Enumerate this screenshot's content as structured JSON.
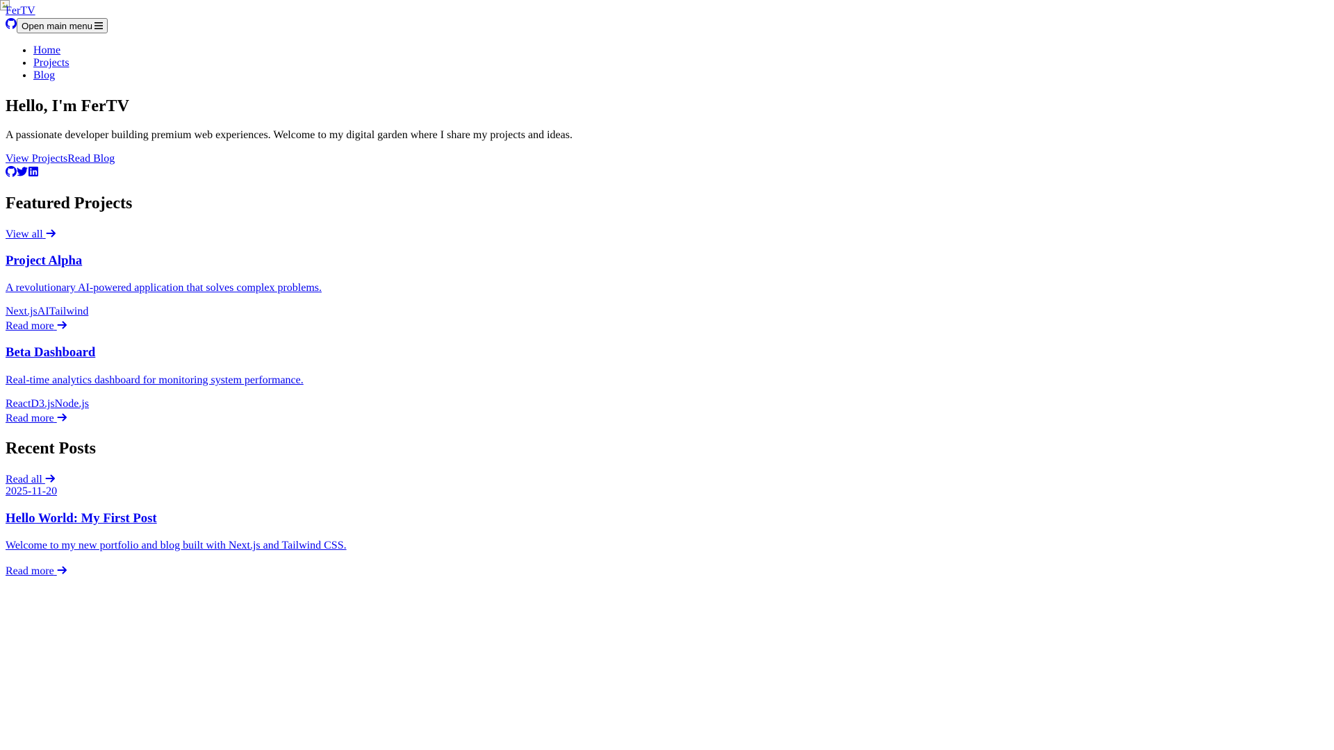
{
  "header": {
    "logo_alt": "FerTV",
    "brand": "FerTV",
    "github_icon": "github-icon",
    "menu_button_label": "Open main menu",
    "menu_icon": "hamburger-icon"
  },
  "nav": {
    "items": [
      {
        "label": "Home"
      },
      {
        "label": "Projects"
      },
      {
        "label": "Blog"
      }
    ]
  },
  "hero": {
    "title": "Hello, I'm FerTV",
    "subtitle": "A passionate developer building premium web experiences. Welcome to my digital garden where I share my projects and ideas.",
    "cta_primary": "View Projects",
    "cta_secondary": "Read Blog",
    "social_icons": [
      "github-icon",
      "twitter-icon",
      "linkedin-icon"
    ]
  },
  "projects": {
    "heading": "Featured Projects",
    "view_all": "View all",
    "items": [
      {
        "title": "Project Alpha",
        "description": "A revolutionary AI-powered application that solves complex problems.",
        "tags": [
          "Next.js",
          "AI",
          "Tailwind"
        ],
        "read_more": "Read more"
      },
      {
        "title": "Beta Dashboard",
        "description": "Real-time analytics dashboard for monitoring system performance.",
        "tags": [
          "React",
          "D3.js",
          "Node.js"
        ],
        "read_more": "Read more"
      }
    ]
  },
  "posts": {
    "heading": "Recent Posts",
    "read_all": "Read all",
    "items": [
      {
        "date": "2025-11-20",
        "title": "Hello World: My First Post",
        "excerpt": "Welcome to my new portfolio and blog built with Next.js and Tailwind CSS.",
        "read_more": "Read more"
      }
    ]
  },
  "colors": {
    "link": "#0000ee",
    "text": "#000000",
    "background": "#ffffff"
  }
}
